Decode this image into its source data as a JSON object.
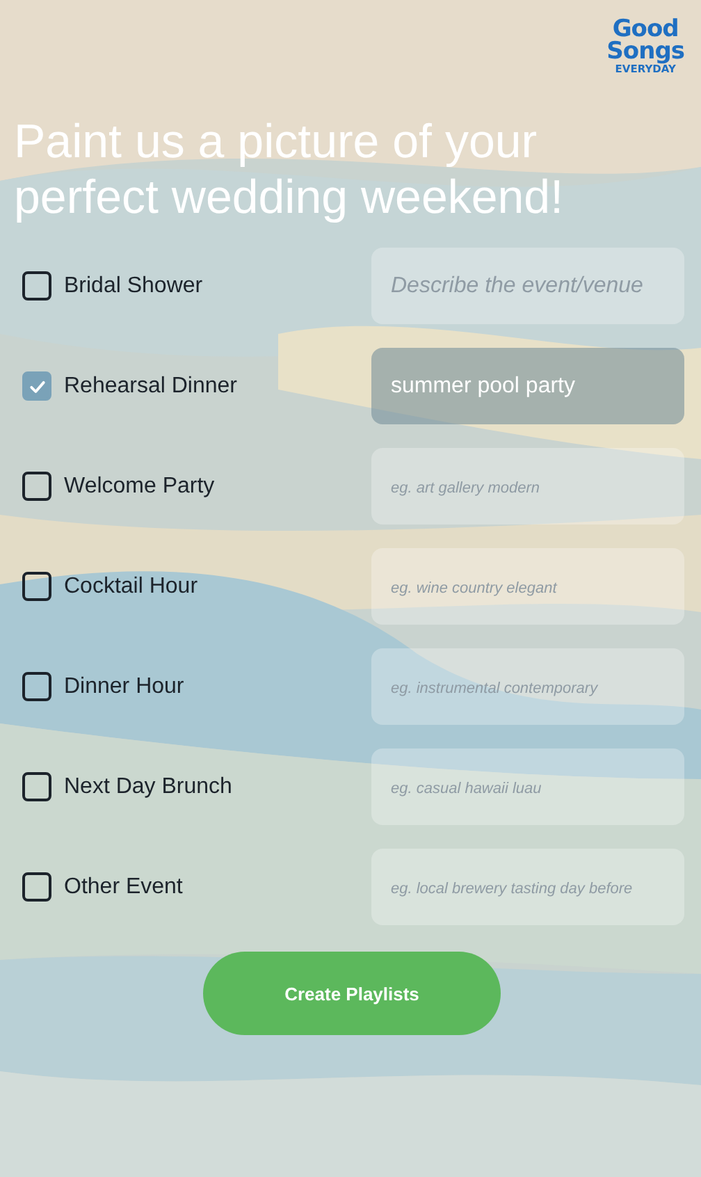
{
  "logo": {
    "line_1": "Good",
    "line_2": "Songs",
    "line_3": "EVERYDAY"
  },
  "heading": "Paint us a picture of your perfect wedding weekend!",
  "events": [
    {
      "label": "Bridal Shower",
      "checked": false,
      "placeholder": "Describe the event/venue"
    },
    {
      "label": "Rehearsal Dinner",
      "checked": true,
      "value": "summer pool party"
    },
    {
      "label": "Welcome Party",
      "checked": false,
      "placeholder": "eg. art gallery modern"
    },
    {
      "label": "Cocktail Hour",
      "checked": false,
      "placeholder": "eg. wine country elegant"
    },
    {
      "label": "Dinner Hour",
      "checked": false,
      "placeholder": "eg. instrumental contemporary"
    },
    {
      "label": "Next Day Brunch",
      "checked": false,
      "placeholder": "eg. casual hawaii luau"
    },
    {
      "label": "Other Event",
      "checked": false,
      "placeholder": "eg. local brewery tasting day before"
    }
  ],
  "button": "Create Playlists"
}
